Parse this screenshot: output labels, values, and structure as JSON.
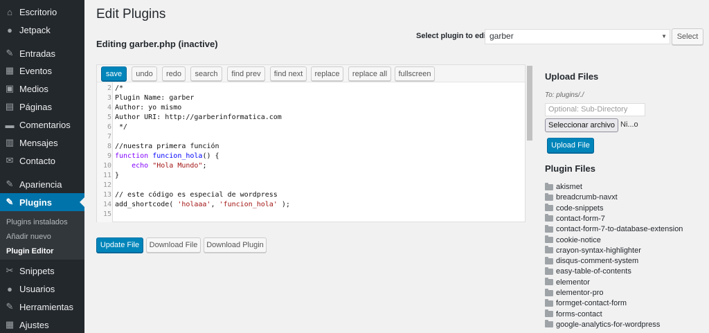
{
  "sidebar": {
    "items": [
      {
        "label": "Escritorio",
        "icon": "dashboard-icon",
        "glyph": "⌂"
      },
      {
        "label": "Jetpack",
        "icon": "jetpack-icon",
        "glyph": "●"
      },
      {
        "label": "Entradas",
        "icon": "pushpin-icon",
        "glyph": "✎"
      },
      {
        "label": "Eventos",
        "icon": "calendar-icon",
        "glyph": "▦"
      },
      {
        "label": "Medios",
        "icon": "media-icon",
        "glyph": "▣"
      },
      {
        "label": "Páginas",
        "icon": "pages-icon",
        "glyph": "▤"
      },
      {
        "label": "Comentarios",
        "icon": "comment-icon",
        "glyph": "▬"
      },
      {
        "label": "Mensajes",
        "icon": "messages-icon",
        "glyph": "▥"
      },
      {
        "label": "Contacto",
        "icon": "mail-icon",
        "glyph": "✉"
      },
      {
        "label": "Apariencia",
        "icon": "appearance-icon",
        "glyph": "✎"
      },
      {
        "label": "Plugins",
        "icon": "plugins-icon",
        "glyph": "✎"
      },
      {
        "label": "Snippets",
        "icon": "snippets-icon",
        "glyph": "✂"
      },
      {
        "label": "Usuarios",
        "icon": "users-icon",
        "glyph": "●"
      },
      {
        "label": "Herramientas",
        "icon": "tools-icon",
        "glyph": "✎"
      },
      {
        "label": "Ajustes",
        "icon": "settings-icon",
        "glyph": "▦"
      }
    ],
    "submenu": [
      "Plugins instalados",
      "Añadir nuevo",
      "Plugin Editor"
    ]
  },
  "page": {
    "title": "Edit Plugins",
    "editing_prefix": "Editing ",
    "editing_file": "garber.php",
    "editing_suffix": " (inactive)"
  },
  "plugin_select": {
    "label": "Select plugin to edit:",
    "value": "garber",
    "button": "Select"
  },
  "toolbar": [
    "save",
    "undo",
    "redo",
    "search",
    "find prev",
    "find next",
    "replace",
    "replace all",
    "fullscreen"
  ],
  "code": {
    "lines": [
      {
        "n": "2",
        "text": "/*",
        "cls": "c-orange"
      },
      {
        "n": "3",
        "text": "Plugin Name: garber",
        "cls": "c-orange"
      },
      {
        "n": "4",
        "text": "Author: yo mismo",
        "cls": "c-orange"
      },
      {
        "n": "5",
        "text": "Author URI: http://garberinformatica.com",
        "cls": "c-orange"
      },
      {
        "n": "6",
        "text": " */",
        "cls": "c-orange"
      },
      {
        "n": "7",
        "text": "",
        "cls": ""
      },
      {
        "n": "8",
        "text": "//nuestra primera función",
        "cls": "c-orange"
      },
      {
        "n": "9",
        "text": "",
        "cls": "fn-line"
      },
      {
        "n": "10",
        "text": "",
        "cls": "echo-line"
      },
      {
        "n": "11",
        "text": "}",
        "cls": ""
      },
      {
        "n": "12",
        "text": "",
        "cls": ""
      },
      {
        "n": "13",
        "text": "// este código es especial de wordpress",
        "cls": "c-orange"
      },
      {
        "n": "14",
        "text": "",
        "cls": "sc-line"
      },
      {
        "n": "15",
        "text": "",
        "cls": ""
      }
    ],
    "fn_kw": "function",
    "fn_name": "funcion_hola",
    "fn_rest": "() {",
    "echo_kw": "echo",
    "echo_str": "\"Hola Mundo\"",
    "echo_end": ";",
    "sc_fn": "add_shortcode( ",
    "sc_arg1": "'holaaa'",
    "sc_sep": ", ",
    "sc_arg2": "'funcion_hola'",
    "sc_end": " );"
  },
  "actions": {
    "update": "Update File",
    "download_file": "Download File",
    "download_plugin": "Download Plugin"
  },
  "upload": {
    "title": "Upload Files",
    "to_label": "To: plugins/./",
    "subdir_placeholder": "Optional: Sub-Directory",
    "file_button": "Seleccionar archivo",
    "no_file": "Ni...o",
    "upload_button": "Upload File"
  },
  "plugin_files": {
    "title": "Plugin Files",
    "folders": [
      "akismet",
      "breadcrumb-navxt",
      "code-snippets",
      "contact-form-7",
      "contact-form-7-to-database-extension",
      "cookie-notice",
      "crayon-syntax-highlighter",
      "disqus-comment-system",
      "easy-table-of-contents",
      "elementor",
      "elementor-pro",
      "formget-contact-form",
      "forms-contact",
      "google-analytics-for-wordpress"
    ]
  },
  "colors": {
    "sidebar_bg": "#23282d",
    "accent": "#0073aa",
    "primary_button": "#0085ba"
  }
}
